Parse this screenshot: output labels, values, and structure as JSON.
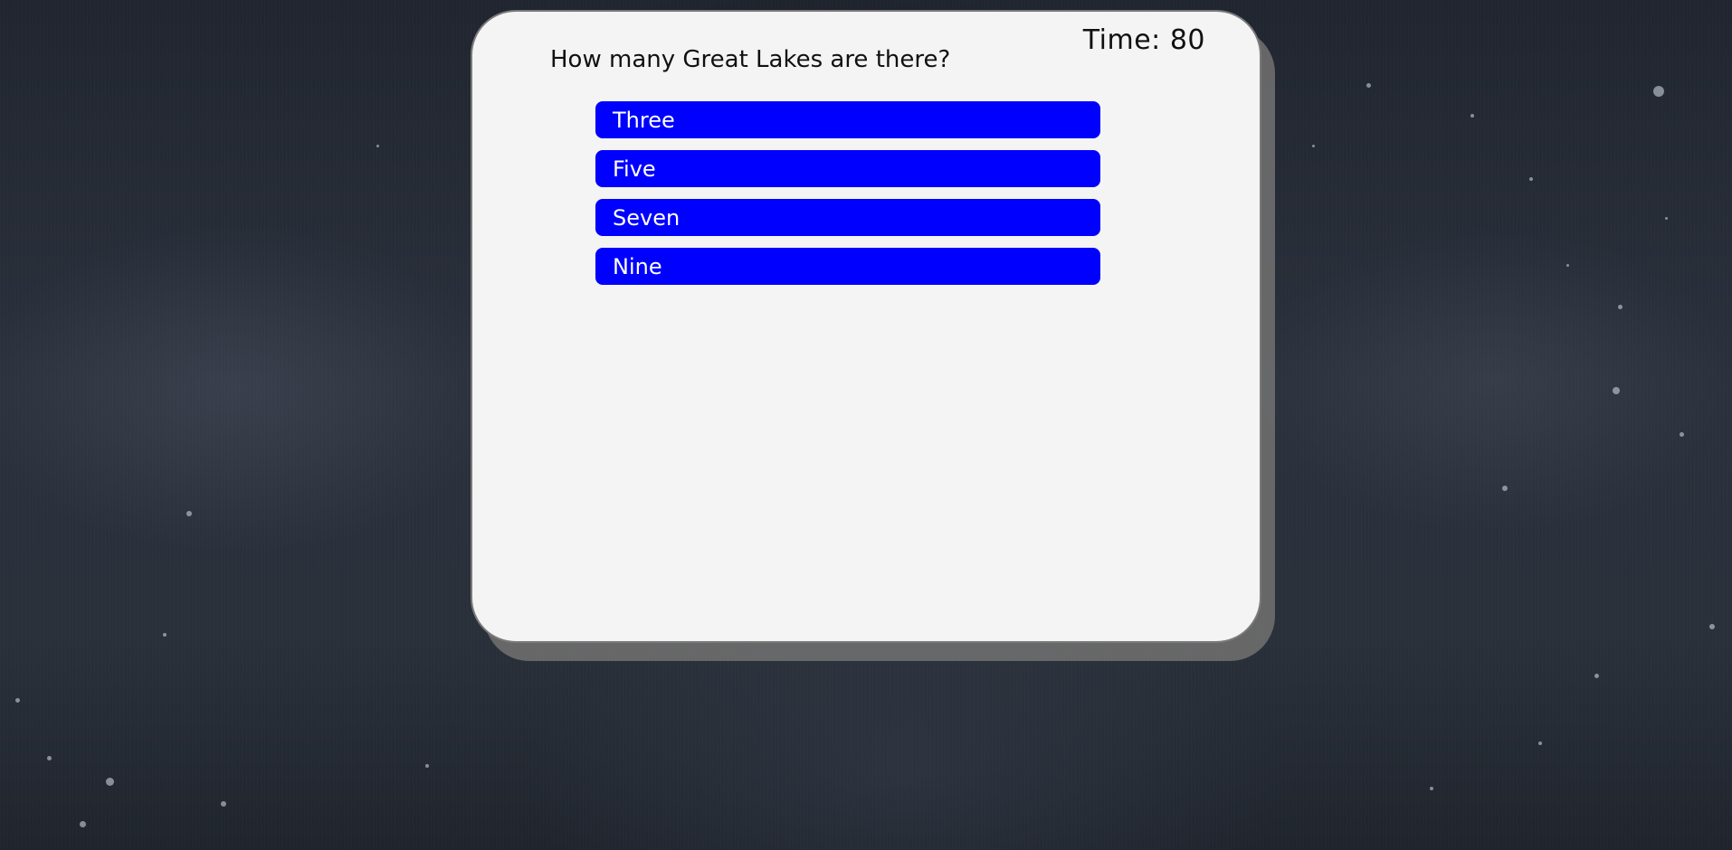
{
  "quiz": {
    "timer_label": "Time:",
    "timer_value": "80",
    "question": "How many Great Lakes are there?",
    "answers": [
      {
        "label": "Three"
      },
      {
        "label": "Five"
      },
      {
        "label": "Seven"
      },
      {
        "label": "Nine"
      }
    ],
    "colors": {
      "card_background": "#f4f4f4",
      "answer_button": "#0000ff",
      "answer_text": "#ffffff",
      "page_background": "#2a303a"
    }
  }
}
